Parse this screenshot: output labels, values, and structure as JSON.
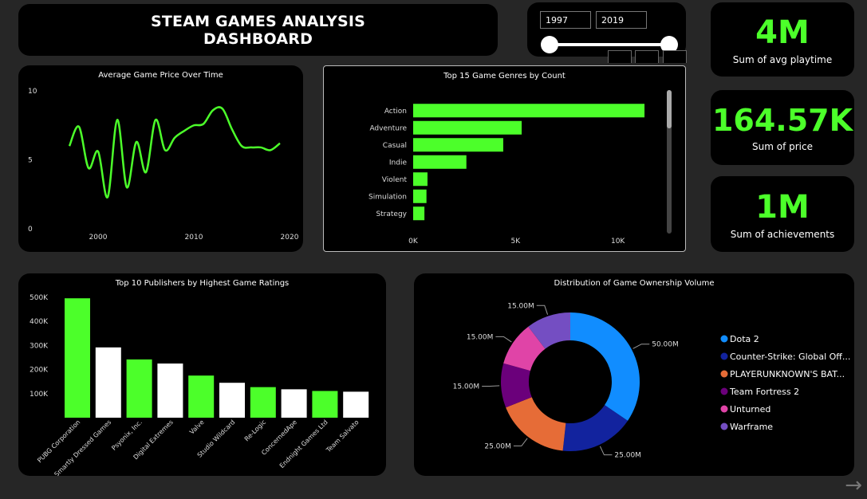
{
  "header": {
    "title_line1": "STEAM GAMES ANALYSIS",
    "title_line2": "DASHBOARD"
  },
  "year_slider": {
    "start": "1997",
    "end": "2019",
    "start_fraction": 0.0,
    "end_fraction": 1.0
  },
  "kpis": [
    {
      "value": "4M",
      "label": "Sum of avg playtime"
    },
    {
      "value": "164.57K",
      "label": "Sum of price"
    },
    {
      "value": "1M",
      "label": "Sum of achievements"
    }
  ],
  "nav": {
    "next_icon": "arrow-right-icon"
  },
  "chart_data": [
    {
      "id": "price",
      "type": "line",
      "title": "Average Game Price Over Time",
      "xlabel": "",
      "ylabel": "",
      "xlim": [
        1995,
        2021
      ],
      "ylim": [
        0,
        10
      ],
      "xticks": [
        "2000",
        "2010",
        "2020"
      ],
      "yticks": [
        "0",
        "5",
        "10"
      ],
      "line_color": "#4cff2a",
      "x": [
        1997,
        1998,
        1999,
        2000,
        2001,
        2002,
        2003,
        2004,
        2005,
        2006,
        2007,
        2008,
        2009,
        2010,
        2011,
        2012,
        2013,
        2014,
        2015,
        2016,
        2017,
        2018,
        2019
      ],
      "values": [
        6.0,
        7.4,
        4.4,
        5.6,
        2.3,
        7.9,
        3.0,
        6.3,
        4.1,
        7.9,
        5.7,
        6.6,
        7.1,
        7.5,
        7.6,
        8.6,
        8.7,
        7.2,
        6.0,
        5.9,
        5.9,
        5.7,
        6.2
      ]
    },
    {
      "id": "genres",
      "type": "bar",
      "orientation": "horizontal",
      "title": "Top 15 Game Genres by Count",
      "xlabel": "",
      "ylabel": "",
      "xlim": [
        0,
        12000
      ],
      "xticks": [
        "0K",
        "5K",
        "10K"
      ],
      "bar_color": "#4cff2a",
      "categories": [
        "Action",
        "Adventure",
        "Casual",
        "Indie",
        "Violent",
        "Simulation",
        "Strategy"
      ],
      "values": [
        11300,
        5300,
        4400,
        2600,
        700,
        650,
        550
      ]
    },
    {
      "id": "publishers",
      "type": "bar",
      "title": "Top 10 Publishers by Highest Game Ratings",
      "xlabel": "",
      "ylabel": "",
      "ylim": [
        0,
        520000
      ],
      "yticks": [
        "100K",
        "200K",
        "300K",
        "400K",
        "500K"
      ],
      "colors": [
        "#4cff2a",
        "#ffffff"
      ],
      "categories": [
        "PUBG Corporation",
        "Smartly Dressed Games",
        "Psyonix, Inc.",
        "Digital Extremes",
        "Valve",
        "Studio Wildcard",
        "Re-Logic",
        "ConcernedApe",
        "Endnight Games Ltd",
        "Team Salvato"
      ],
      "values": [
        496000,
        292000,
        242000,
        225000,
        175000,
        145000,
        127000,
        118000,
        111000,
        108000
      ]
    },
    {
      "id": "ownership",
      "type": "pie",
      "donut": true,
      "title": "Distribution of Game Ownership Volume",
      "categories": [
        "Dota 2",
        "Counter-Strike: Global Off...",
        "PLAYERUNKNOWN'S BAT...",
        "Team Fortress 2",
        "Unturned",
        "Warframe"
      ],
      "values": [
        50,
        25,
        25,
        15,
        15,
        15
      ],
      "labels": [
        "50.00M",
        "25.00M",
        "25.00M",
        "15.00M",
        "15.00M",
        "15.00M"
      ],
      "colors": [
        "#118dff",
        "#12239e",
        "#e66c37",
        "#6b007b",
        "#e044a7",
        "#744ec2"
      ],
      "legend": "right"
    }
  ]
}
